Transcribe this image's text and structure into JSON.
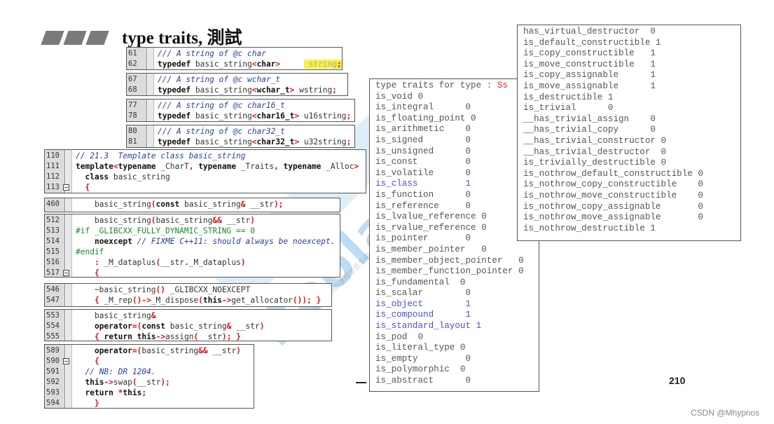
{
  "slide": {
    "title": "type traits, 測試",
    "page_number": "210",
    "credit": "CSDN @Mhypnos",
    "watermark": {
      "brand": "Boolan",
      "site_cn": "博览网",
      "notice": "本讲义仅供侯捷老师的课程学员专用，请勿传播以保护知识产权。"
    }
  },
  "code_snippets": [
    {
      "id": "string-typedef",
      "lines": [
        {
          "n": "61",
          "html": "<span class='cm'>/// A string of @c char</span>"
        },
        {
          "n": "62",
          "html": "<span class='kw'>typedef</span> basic_string<span class='op'>&lt;</span><span class='kw'>char</span><span class='op'>&gt;</span>     <span class='hl'> string<span class='op'>;</span> </span>"
        }
      ]
    },
    {
      "id": "wstring-typedef",
      "lines": [
        {
          "n": "67",
          "html": "<span class='cm'>/// A string of @c wchar_t</span>"
        },
        {
          "n": "68",
          "html": "<span class='kw'>typedef</span> basic_string<span class='op'>&lt;</span><span class='kw'>wchar_t</span><span class='op'>&gt;</span> wstring<span class='op'>;</span>"
        }
      ]
    },
    {
      "id": "u16string-typedef",
      "lines": [
        {
          "n": "77",
          "html": "<span class='cm'>/// A string of @c char16_t</span>"
        },
        {
          "n": "78",
          "html": "<span class='kw'>typedef</span> basic_string<span class='op'>&lt;</span><span class='kw'>char16_t</span><span class='op'>&gt;</span> u16string<span class='op'>;</span>"
        }
      ]
    },
    {
      "id": "u32string-typedef",
      "lines": [
        {
          "n": "80",
          "html": "<span class='cm'>/// A string of @c char32_t</span>"
        },
        {
          "n": "81",
          "html": "<span class='kw'>typedef</span> basic_string<span class='op'>&lt;</span><span class='kw'>char32_t</span><span class='op'>&gt;</span> u32string<span class='op'>;</span>"
        }
      ]
    },
    {
      "id": "basic-string-class",
      "lines": [
        {
          "n": "110",
          "html": "<span class='cm'>// 21.3  Template class basic_string</span>"
        },
        {
          "n": "111",
          "html": "<span class='kw'>template</span><span class='op'>&lt;</span><span class='kw'>typename</span> _CharT<span class='op'>,</span> <span class='kw'>typename</span> _Traits<span class='op'>,</span> <span class='kw'>typename</span> _Alloc<span class='op'>&gt;</span>"
        },
        {
          "n": "112",
          "html": "  <span class='kw'>class</span> basic_string"
        },
        {
          "n": "113",
          "fold": true,
          "html": "  <span class='op'>{</span>"
        }
      ]
    },
    {
      "id": "copy-ctor",
      "lines": [
        {
          "n": "460",
          "html": "    basic_string<span class='op'>(</span><span class='kw'>const</span> basic_string<span class='op'>&amp;</span> __str<span class='op'>);</span>"
        }
      ]
    },
    {
      "id": "move-ctor",
      "lines": [
        {
          "n": "512",
          "html": "    basic_string<span class='op'>(</span>basic_string<span class='op'>&amp;&amp;</span> __str<span class='op'>)</span>"
        },
        {
          "n": "513",
          "html": "<span class='pp'>#if _GLIBCXX_FULLY_DYNAMIC_STRING == 0</span>"
        },
        {
          "n": "514",
          "html": "    <span class='kw'>noexcept</span> <span class='cm'>// FIXME C++11: should always be noexcept.</span>"
        },
        {
          "n": "515",
          "html": "<span class='pp'>#endif</span>"
        },
        {
          "n": "516",
          "html": "    <span class='op'>:</span> _M_dataplus<span class='op'>(</span>__str<span class='op'>.</span>_M_dataplus<span class='op'>)</span>"
        },
        {
          "n": "517",
          "fold": true,
          "html": "    <span class='op'>{</span>"
        }
      ]
    },
    {
      "id": "destructor",
      "lines": [
        {
          "n": "546",
          "html": "    ~basic_string<span class='op'>()</span> _GLIBCXX_NOEXCEPT"
        },
        {
          "n": "547",
          "html": "    <span class='op'>{</span> _M_rep<span class='op'>()-&gt;</span>_M_dispose<span class='op'>(</span><span class='kw'>this</span><span class='op'>-&gt;</span>get_allocator<span class='op'>());</span> <span class='op'>}</span>"
        }
      ]
    },
    {
      "id": "copy-assign",
      "lines": [
        {
          "n": "553",
          "html": "    basic_string<span class='op'>&amp;</span>"
        },
        {
          "n": "554",
          "html": "    <span class='kw'>operator</span><span class='op'>=(</span><span class='kw'>const</span> basic_string<span class='op'>&amp;</span> __str<span class='op'>)</span>"
        },
        {
          "n": "555",
          "html": "    <span class='op'>{</span> <span class='kw'>return</span> <span class='kw'>this</span><span class='op'>-&gt;</span>assign<span class='op'>(</span>__str<span class='op'>);</span> <span class='op'>}</span>"
        }
      ]
    },
    {
      "id": "move-assign",
      "lines": [
        {
          "n": "589",
          "html": "    <span class='kw'>operator</span><span class='op'>=(</span>basic_string<span class='op'>&amp;&amp;</span> __str<span class='op'>)</span>"
        },
        {
          "n": "590",
          "fold": true,
          "html": "    <span class='op'>{</span>"
        },
        {
          "n": "591",
          "html": "  <span class='cm'>// NB: DR 1204.</span>"
        },
        {
          "n": "592",
          "html": "  <span class='kw'>this</span><span class='op'>-&gt;</span>swap<span class='op'>(</span>__str<span class='op'>);</span>"
        },
        {
          "n": "593",
          "html": "  <span class='kw'>return</span> <span class='op'>*</span><span class='kw'>this</span><span class='op'>;</span>"
        },
        {
          "n": "594",
          "html": "    <span class='op'>}</span>"
        }
      ]
    }
  ],
  "traits_panel_left": {
    "header_label": "type traits for type : ",
    "header_type": "Ss",
    "rows": [
      {
        "name": "is_void",
        "pad": " ",
        "value": "0",
        "hi": false
      },
      {
        "name": "is_integral",
        "pad": "      ",
        "value": "0",
        "hi": false
      },
      {
        "name": "is_floating_point",
        "pad": " ",
        "value": "0",
        "hi": false
      },
      {
        "name": "is_arithmetic",
        "pad": "    ",
        "value": "0",
        "hi": false
      },
      {
        "name": "is_signed",
        "pad": "        ",
        "value": "0",
        "hi": false
      },
      {
        "name": "is_unsigned",
        "pad": "      ",
        "value": "0",
        "hi": false
      },
      {
        "name": "is_const",
        "pad": "         ",
        "value": "0",
        "hi": false
      },
      {
        "name": "is_volatile",
        "pad": "      ",
        "value": "0",
        "hi": false
      },
      {
        "name": "is_class",
        "pad": "         ",
        "value": "1",
        "hi": true
      },
      {
        "name": "is_function",
        "pad": "      ",
        "value": "0",
        "hi": false
      },
      {
        "name": "is_reference",
        "pad": "     ",
        "value": "0",
        "hi": false
      },
      {
        "name": "is_lvalue_reference",
        "pad": " ",
        "value": "0",
        "hi": false
      },
      {
        "name": "is_rvalue_reference",
        "pad": " ",
        "value": "0",
        "hi": false
      },
      {
        "name": "is_pointer",
        "pad": "       ",
        "value": "0",
        "hi": false
      },
      {
        "name": "is_member_pointer",
        "pad": "   ",
        "value": "0",
        "hi": false
      },
      {
        "name": "is_member_object_pointer",
        "pad": "   ",
        "value": "0",
        "hi": false
      },
      {
        "name": "is_member_function_pointer",
        "pad": " ",
        "value": "0",
        "hi": false
      },
      {
        "name": "is_fundamental",
        "pad": "  ",
        "value": "0",
        "hi": false
      },
      {
        "name": "is_scalar",
        "pad": "        ",
        "value": "0",
        "hi": false
      },
      {
        "name": "is_object",
        "pad": "        ",
        "value": "1",
        "hi": true
      },
      {
        "name": "is_compound",
        "pad": "      ",
        "value": "1",
        "hi": true
      },
      {
        "name": "is_standard_layout",
        "pad": " ",
        "value": "1",
        "hi": true
      },
      {
        "name": "is_pod",
        "pad": "  ",
        "value": "0",
        "hi": false
      },
      {
        "name": "is_literal_type",
        "pad": " ",
        "value": "0",
        "hi": false
      },
      {
        "name": "is_empty",
        "pad": "         ",
        "value": "0",
        "hi": false
      },
      {
        "name": "is_polymorphic",
        "pad": "  ",
        "value": "0",
        "hi": false
      },
      {
        "name": "is_abstract",
        "pad": "      ",
        "value": "0",
        "hi": false
      }
    ]
  },
  "traits_panel_right": {
    "rows": [
      {
        "name": "has_virtual_destructor",
        "pad": "  ",
        "value": "0"
      },
      {
        "name": "is_default_constructible",
        "pad": " ",
        "value": "1"
      },
      {
        "name": "is_copy_constructible",
        "pad": "   ",
        "value": "1"
      },
      {
        "name": "is_move_constructible",
        "pad": "   ",
        "value": "1"
      },
      {
        "name": "is_copy_assignable",
        "pad": "      ",
        "value": "1"
      },
      {
        "name": "is_move_assignable",
        "pad": "      ",
        "value": "1"
      },
      {
        "name": "is_destructible",
        "pad": " ",
        "value": "1"
      },
      {
        "name": "is_trivial",
        "pad": "      ",
        "value": "0"
      },
      {
        "name": "__has_trivial_assign",
        "pad": "    ",
        "value": "0"
      },
      {
        "name": "__has_trivial_copy",
        "pad": "      ",
        "value": "0"
      },
      {
        "name": "__has_trivial_constructor",
        "pad": " ",
        "value": "0"
      },
      {
        "name": "__has_trivial_destructor",
        "pad": "  ",
        "value": "0"
      },
      {
        "name": "is_trivially_destructible",
        "pad": " ",
        "value": "0"
      },
      {
        "name": "is_nothrow_default_constructible",
        "pad": " ",
        "value": "0"
      },
      {
        "name": "is_nothrow_copy_constructible",
        "pad": "    ",
        "value": "0"
      },
      {
        "name": "is_nothrow_move_constructible",
        "pad": "    ",
        "value": "0"
      },
      {
        "name": "is_nothrow_copy_assignable",
        "pad": "       ",
        "value": "0"
      },
      {
        "name": "is_nothrow_move_assignable",
        "pad": "       ",
        "value": "0"
      },
      {
        "name": "is_nothrow_destructible",
        "pad": " ",
        "value": "1"
      }
    ]
  }
}
